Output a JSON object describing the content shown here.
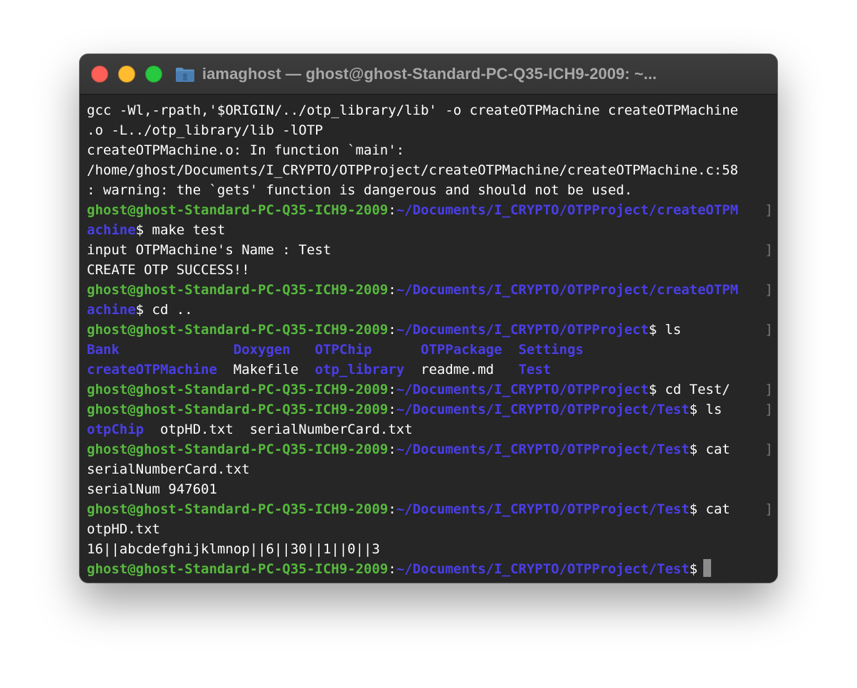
{
  "window": {
    "title": "iamaghost — ghost@ghost-Standard-PC-Q35-ICH9-2009: ~..."
  },
  "icons": {
    "close": "close-button",
    "minimize": "minimize-button",
    "zoom": "zoom-button",
    "title": "folder-icon"
  },
  "colors": {
    "terminal_bg": "#262626",
    "prompt_user": "#57b93e",
    "prompt_path": "#4a3ee6",
    "text": "#ffffff",
    "close": "#fe5f57",
    "minimize": "#febc2e",
    "zoom": "#28c840"
  },
  "terminal": {
    "lines": [
      {
        "segments": [
          {
            "text": "gcc -Wl,-rpath,'$ORIGIN/../otp_library/lib' -o createOTPMachine createOTPMachine",
            "style": "white"
          }
        ]
      },
      {
        "segments": [
          {
            "text": ".o -L../otp_library/lib -lOTP",
            "style": "white"
          }
        ]
      },
      {
        "segments": [
          {
            "text": "createOTPMachine.o: In function `main':",
            "style": "white"
          }
        ]
      },
      {
        "segments": [
          {
            "text": "/home/ghost/Documents/I_CRYPTO/OTPProject/createOTPMachine/createOTPMachine.c:58",
            "style": "white"
          }
        ]
      },
      {
        "segments": [
          {
            "text": ": warning: the `gets' function is dangerous and should not be used.",
            "style": "white"
          }
        ]
      },
      {
        "left_bracket": "[",
        "right_bracket": "]",
        "segments": [
          {
            "text": "ghost@ghost-Standard-PC-Q35-ICH9-2009",
            "style": "green"
          },
          {
            "text": ":",
            "style": "white"
          },
          {
            "text": "~/Documents/I_CRYPTO/OTPProject/createOTPM",
            "style": "blue"
          }
        ]
      },
      {
        "segments": [
          {
            "text": "achine",
            "style": "blue"
          },
          {
            "text": "$ make test",
            "style": "white"
          }
        ]
      },
      {
        "left_bracket": "[",
        "right_bracket": "]",
        "segments": [
          {
            "text": "input OTPMachine's Name : Test",
            "style": "white"
          }
        ]
      },
      {
        "segments": [
          {
            "text": "CREATE OTP SUCCESS!!",
            "style": "white"
          }
        ]
      },
      {
        "left_bracket": "[",
        "right_bracket": "]",
        "segments": [
          {
            "text": "ghost@ghost-Standard-PC-Q35-ICH9-2009",
            "style": "green"
          },
          {
            "text": ":",
            "style": "white"
          },
          {
            "text": "~/Documents/I_CRYPTO/OTPProject/createOTPM",
            "style": "blue"
          }
        ]
      },
      {
        "segments": [
          {
            "text": "achine",
            "style": "blue"
          },
          {
            "text": "$ cd ..",
            "style": "white"
          }
        ]
      },
      {
        "left_bracket": "[",
        "right_bracket": "]",
        "segments": [
          {
            "text": "ghost@ghost-Standard-PC-Q35-ICH9-2009",
            "style": "green"
          },
          {
            "text": ":",
            "style": "white"
          },
          {
            "text": "~/Documents/I_CRYPTO/OTPProject",
            "style": "blue"
          },
          {
            "text": "$ ls",
            "style": "white"
          }
        ]
      },
      {
        "segments": [
          {
            "text": "Bank              ",
            "style": "blue"
          },
          {
            "text": "Doxygen",
            "style": "blue"
          },
          {
            "text": "   ",
            "style": "white"
          },
          {
            "text": "OTPChip",
            "style": "blue"
          },
          {
            "text": "      ",
            "style": "white"
          },
          {
            "text": "OTPPackage",
            "style": "blue"
          },
          {
            "text": "  ",
            "style": "white"
          },
          {
            "text": "Settings",
            "style": "blue"
          }
        ]
      },
      {
        "segments": [
          {
            "text": "createOTPMachine",
            "style": "blue"
          },
          {
            "text": "  Makefile  ",
            "style": "white"
          },
          {
            "text": "otp_library",
            "style": "blue"
          },
          {
            "text": "  readme.md   ",
            "style": "white"
          },
          {
            "text": "Test",
            "style": "blue"
          }
        ]
      },
      {
        "left_bracket": "[",
        "right_bracket": "]",
        "segments": [
          {
            "text": "ghost@ghost-Standard-PC-Q35-ICH9-2009",
            "style": "green"
          },
          {
            "text": ":",
            "style": "white"
          },
          {
            "text": "~/Documents/I_CRYPTO/OTPProject",
            "style": "blue"
          },
          {
            "text": "$ cd Test/",
            "style": "white"
          }
        ]
      },
      {
        "left_bracket": "[",
        "right_bracket": "]",
        "segments": [
          {
            "text": "ghost@ghost-Standard-PC-Q35-ICH9-2009",
            "style": "green"
          },
          {
            "text": ":",
            "style": "white"
          },
          {
            "text": "~/Documents/I_CRYPTO/OTPProject/Test",
            "style": "blue"
          },
          {
            "text": "$ ls",
            "style": "white"
          }
        ]
      },
      {
        "segments": [
          {
            "text": "otpChip",
            "style": "blue"
          },
          {
            "text": "  otpHD.txt  serialNumberCard.txt",
            "style": "white"
          }
        ]
      },
      {
        "left_bracket": "[",
        "right_bracket": "]",
        "segments": [
          {
            "text": "ghost@ghost-Standard-PC-Q35-ICH9-2009",
            "style": "green"
          },
          {
            "text": ":",
            "style": "white"
          },
          {
            "text": "~/Documents/I_CRYPTO/OTPProject/Test",
            "style": "blue"
          },
          {
            "text": "$ cat",
            "style": "white"
          }
        ]
      },
      {
        "segments": [
          {
            "text": "serialNumberCard.txt",
            "style": "white"
          }
        ]
      },
      {
        "segments": [
          {
            "text": "serialNum 947601",
            "style": "white"
          }
        ]
      },
      {
        "left_bracket": "[",
        "right_bracket": "]",
        "segments": [
          {
            "text": "ghost@ghost-Standard-PC-Q35-ICH9-2009",
            "style": "green"
          },
          {
            "text": ":",
            "style": "white"
          },
          {
            "text": "~/Documents/I_CRYPTO/OTPProject/Test",
            "style": "blue"
          },
          {
            "text": "$ cat",
            "style": "white"
          }
        ]
      },
      {
        "segments": [
          {
            "text": "otpHD.txt",
            "style": "white"
          }
        ]
      },
      {
        "segments": [
          {
            "text": "16||abcdefghijklmnop||6||30||1||0||3",
            "style": "white"
          }
        ]
      },
      {
        "cursor": true,
        "segments": [
          {
            "text": "ghost@ghost-Standard-PC-Q35-ICH9-2009",
            "style": "green"
          },
          {
            "text": ":",
            "style": "white"
          },
          {
            "text": "~/Documents/I_CRYPTO/OTPProject/Test",
            "style": "blue"
          },
          {
            "text": "$",
            "style": "white"
          }
        ]
      }
    ]
  }
}
